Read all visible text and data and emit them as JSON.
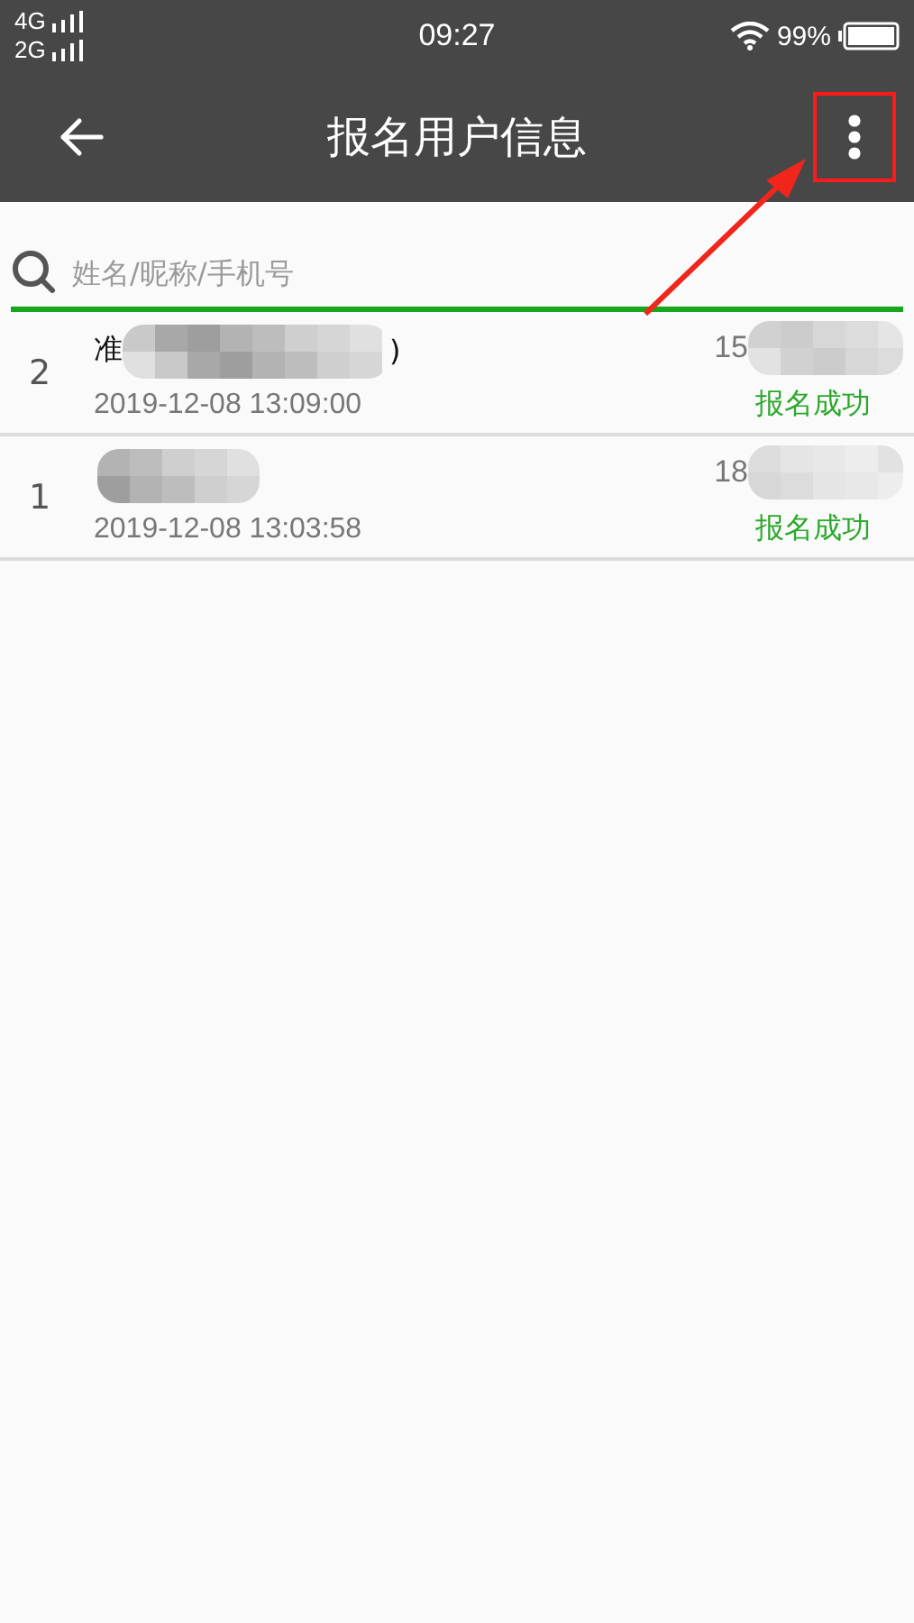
{
  "status_bar": {
    "networks": [
      "4G",
      "2G"
    ],
    "time": "09:27",
    "battery": "99%"
  },
  "header": {
    "title": "报名用户信息"
  },
  "search": {
    "placeholder": "姓名/昵称/手机号"
  },
  "registrants": [
    {
      "index": "2",
      "name_start": "准",
      "name_end": ")",
      "time": "2019-12-08 13:09:00",
      "phone_start": "15",
      "status": "报名成功"
    },
    {
      "index": "1",
      "time": "2019-12-08 13:03:58",
      "phone_start": "18",
      "status": "报名成功"
    }
  ],
  "annotation": {
    "highlight": true
  }
}
